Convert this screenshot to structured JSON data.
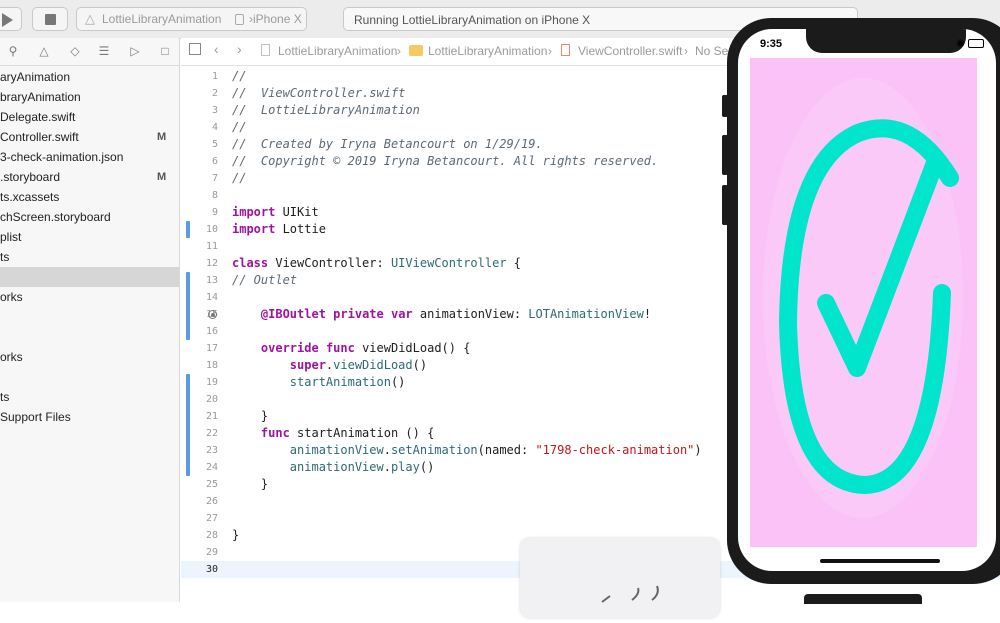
{
  "toolbar": {
    "scheme_target": "LottieLibraryAnimation",
    "scheme_separator": "›",
    "scheme_device": "iPhone X",
    "status": "Running LottieLibraryAnimation on iPhone X"
  },
  "navigator": {
    "items": [
      {
        "label": "aryAnimation",
        "badge": ""
      },
      {
        "label": "braryAnimation",
        "badge": ""
      },
      {
        "label": "Delegate.swift",
        "badge": ""
      },
      {
        "label": "Controller.swift",
        "badge": "M"
      },
      {
        "label": "3-check-animation.json",
        "badge": ""
      },
      {
        "label": ".storyboard",
        "badge": "M"
      },
      {
        "label": "ts.xcassets",
        "badge": ""
      },
      {
        "label": "chScreen.storyboard",
        "badge": ""
      },
      {
        "label": "plist",
        "badge": ""
      },
      {
        "label": "ts",
        "badge": ""
      },
      {
        "label": "",
        "badge": ""
      },
      {
        "label": "orks",
        "badge": ""
      },
      {
        "label": "",
        "badge": ""
      },
      {
        "label": "",
        "badge": ""
      },
      {
        "label": "orks",
        "badge": ""
      },
      {
        "label": "",
        "badge": ""
      },
      {
        "label": "ts",
        "badge": ""
      },
      {
        "label": " Support Files",
        "badge": ""
      }
    ]
  },
  "jumpbar": {
    "project": "LottieLibraryAnimation",
    "group": "LottieLibraryAnimation",
    "file": "ViewController.swift",
    "selection": "No Se"
  },
  "editor": {
    "lines": [
      {
        "n": "1",
        "parts": [
          {
            "t": "//",
            "c": "c"
          }
        ]
      },
      {
        "n": "2",
        "parts": [
          {
            "t": "//  ViewController.swift",
            "c": "c"
          }
        ]
      },
      {
        "n": "3",
        "parts": [
          {
            "t": "//  LottieLibraryAnimation",
            "c": "c"
          }
        ]
      },
      {
        "n": "4",
        "parts": [
          {
            "t": "//",
            "c": "c"
          }
        ]
      },
      {
        "n": "5",
        "parts": [
          {
            "t": "//  Created by Iryna Betancourt on 1/29/19.",
            "c": "c"
          }
        ]
      },
      {
        "n": "6",
        "parts": [
          {
            "t": "//  Copyright © 2019 Iryna Betancourt. All rights reserved.",
            "c": "c"
          }
        ]
      },
      {
        "n": "7",
        "parts": [
          {
            "t": "//",
            "c": "c"
          }
        ]
      },
      {
        "n": "8",
        "parts": []
      },
      {
        "n": "9",
        "parts": [
          {
            "t": "import",
            "c": "k"
          },
          {
            "t": " UIKit",
            "c": ""
          }
        ]
      },
      {
        "n": "10",
        "parts": [
          {
            "t": "import",
            "c": "k"
          },
          {
            "t": " Lottie",
            "c": ""
          }
        ]
      },
      {
        "n": "11",
        "parts": []
      },
      {
        "n": "12",
        "parts": [
          {
            "t": "class",
            "c": "k"
          },
          {
            "t": " ViewController: ",
            "c": ""
          },
          {
            "t": "UIViewController",
            "c": "t"
          },
          {
            "t": " {",
            "c": ""
          }
        ]
      },
      {
        "n": "13",
        "parts": [
          {
            "t": "// Outlet",
            "c": "c"
          }
        ]
      },
      {
        "n": "14",
        "parts": []
      },
      {
        "n": "15",
        "parts": [
          {
            "t": "    ",
            "c": ""
          },
          {
            "t": "@IBOutlet",
            "c": "k"
          },
          {
            "t": " ",
            "c": ""
          },
          {
            "t": "private",
            "c": "k"
          },
          {
            "t": " ",
            "c": ""
          },
          {
            "t": "var",
            "c": "k"
          },
          {
            "t": " animationView: ",
            "c": ""
          },
          {
            "t": "LOTAnimationView",
            "c": "t"
          },
          {
            "t": "!",
            "c": ""
          }
        ]
      },
      {
        "n": "16",
        "parts": []
      },
      {
        "n": "17",
        "parts": [
          {
            "t": "    ",
            "c": ""
          },
          {
            "t": "override",
            "c": "k"
          },
          {
            "t": " ",
            "c": ""
          },
          {
            "t": "func",
            "c": "k"
          },
          {
            "t": " viewDidLoad() {",
            "c": ""
          }
        ]
      },
      {
        "n": "18",
        "parts": [
          {
            "t": "        ",
            "c": ""
          },
          {
            "t": "super",
            "c": "k"
          },
          {
            "t": ".",
            "c": ""
          },
          {
            "t": "viewDidLoad",
            "c": "t"
          },
          {
            "t": "()",
            "c": ""
          }
        ]
      },
      {
        "n": "19",
        "parts": [
          {
            "t": "        ",
            "c": ""
          },
          {
            "t": "startAnimation",
            "c": "t"
          },
          {
            "t": "()",
            "c": ""
          }
        ]
      },
      {
        "n": "20",
        "parts": []
      },
      {
        "n": "21",
        "parts": [
          {
            "t": "    }",
            "c": ""
          }
        ]
      },
      {
        "n": "22",
        "parts": [
          {
            "t": "    ",
            "c": ""
          },
          {
            "t": "func",
            "c": "k"
          },
          {
            "t": " startAnimation () {",
            "c": ""
          }
        ]
      },
      {
        "n": "23",
        "parts": [
          {
            "t": "        ",
            "c": ""
          },
          {
            "t": "animationView",
            "c": "t"
          },
          {
            "t": ".",
            "c": ""
          },
          {
            "t": "setAnimation",
            "c": "t"
          },
          {
            "t": "(named: ",
            "c": ""
          },
          {
            "t": "\"1798-check-animation\"",
            "c": "s"
          },
          {
            "t": ")",
            "c": ""
          }
        ]
      },
      {
        "n": "24",
        "parts": [
          {
            "t": "        ",
            "c": ""
          },
          {
            "t": "animationView",
            "c": "t"
          },
          {
            "t": ".",
            "c": ""
          },
          {
            "t": "play",
            "c": "t"
          },
          {
            "t": "()",
            "c": ""
          }
        ]
      },
      {
        "n": "25",
        "parts": [
          {
            "t": "    }",
            "c": ""
          }
        ]
      },
      {
        "n": "26",
        "parts": []
      },
      {
        "n": "27",
        "parts": []
      },
      {
        "n": "28",
        "parts": [
          {
            "t": "}",
            "c": ""
          }
        ]
      },
      {
        "n": "29",
        "parts": []
      },
      {
        "n": "30",
        "parts": []
      }
    ],
    "current_line": "30"
  },
  "simulator": {
    "time": "9:35",
    "background_color": "#fbc2f7",
    "check_color": "#00e5cc"
  }
}
